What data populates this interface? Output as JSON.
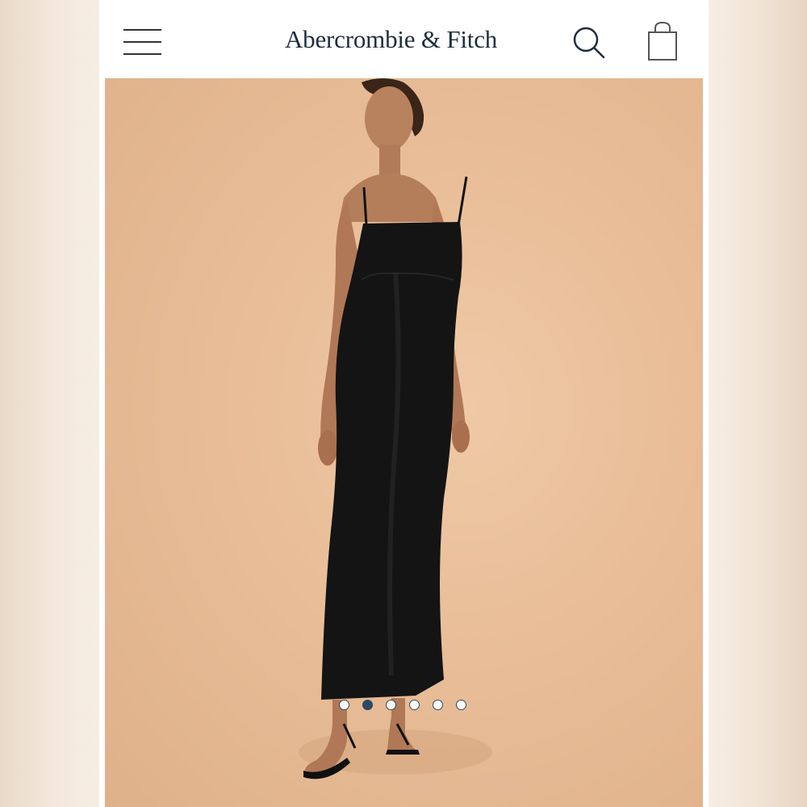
{
  "header": {
    "brand": "Abercrombie & Fitch",
    "menu_icon": "hamburger-menu-icon",
    "search_icon": "search-icon",
    "bag_icon": "shopping-bag-icon"
  },
  "hero": {
    "background_color": "#e8bd97",
    "dress_color": "#141414",
    "carousel": {
      "total": 6,
      "active_index": 1
    }
  },
  "colors": {
    "brand_text": "#1f2d3d",
    "active_dot": "#2c4a63"
  }
}
